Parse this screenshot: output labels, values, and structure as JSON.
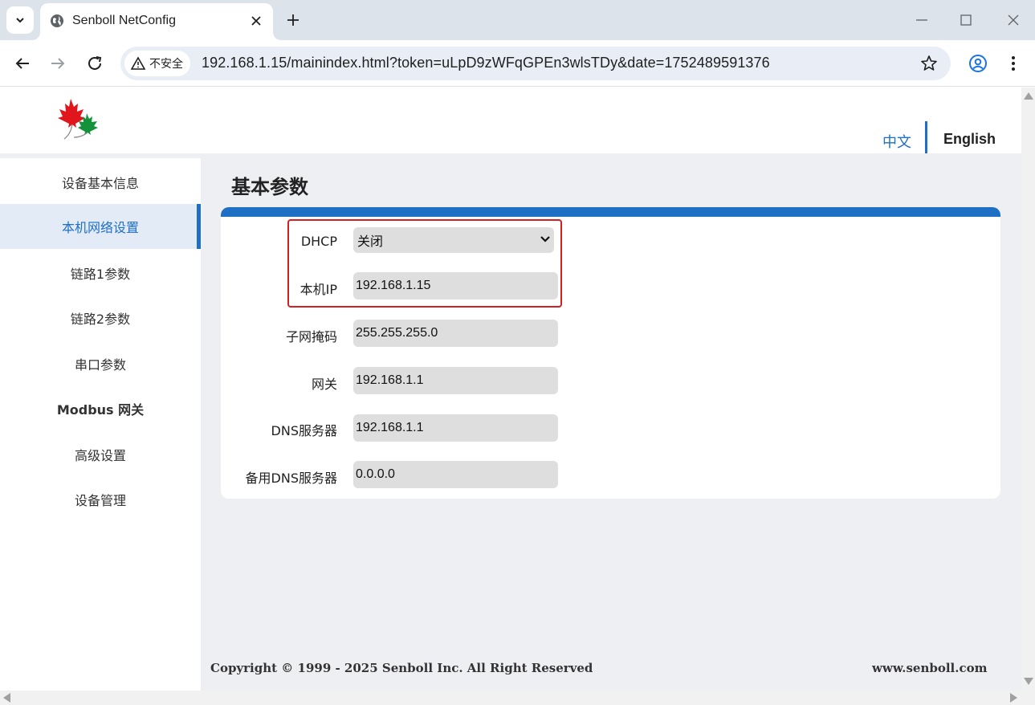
{
  "browser": {
    "tab_title": "Senboll NetConfig",
    "security_label": "不安全",
    "url": "192.168.1.15/mainindex.html?token=uLpD9zWFqGPEn3wlsTDy&date=1752489591376",
    "accent_color": "#1f6fc4"
  },
  "header": {
    "lang_zh": "中文",
    "lang_en": "English"
  },
  "sidebar": {
    "items": [
      {
        "label": "设备基本信息"
      },
      {
        "label": "本机网络设置"
      },
      {
        "label": "链路1参数"
      },
      {
        "label": "链路2参数"
      },
      {
        "label": "串口参数"
      },
      {
        "label": "Modbus 网关"
      },
      {
        "label": "高级设置"
      },
      {
        "label": "设备管理"
      }
    ],
    "active_index": 1
  },
  "main": {
    "section_title": "基本参数",
    "fields": {
      "dhcp": {
        "label": "DHCP",
        "value": "关闭"
      },
      "ip": {
        "label": "本机IP",
        "value": "192.168.1.15"
      },
      "subnet": {
        "label": "子网掩码",
        "value": "255.255.255.0"
      },
      "gateway": {
        "label": "网关",
        "value": "192.168.1.1"
      },
      "dns": {
        "label": "DNS服务器",
        "value": "192.168.1.1"
      },
      "dns_backup": {
        "label": "备用DNS服务器",
        "value": "0.0.0.0"
      }
    }
  },
  "footer": {
    "copyright": "Copyright © 1999 - 2025 Senboll Inc. All Right Reserved",
    "website": "www.senboll.com"
  }
}
